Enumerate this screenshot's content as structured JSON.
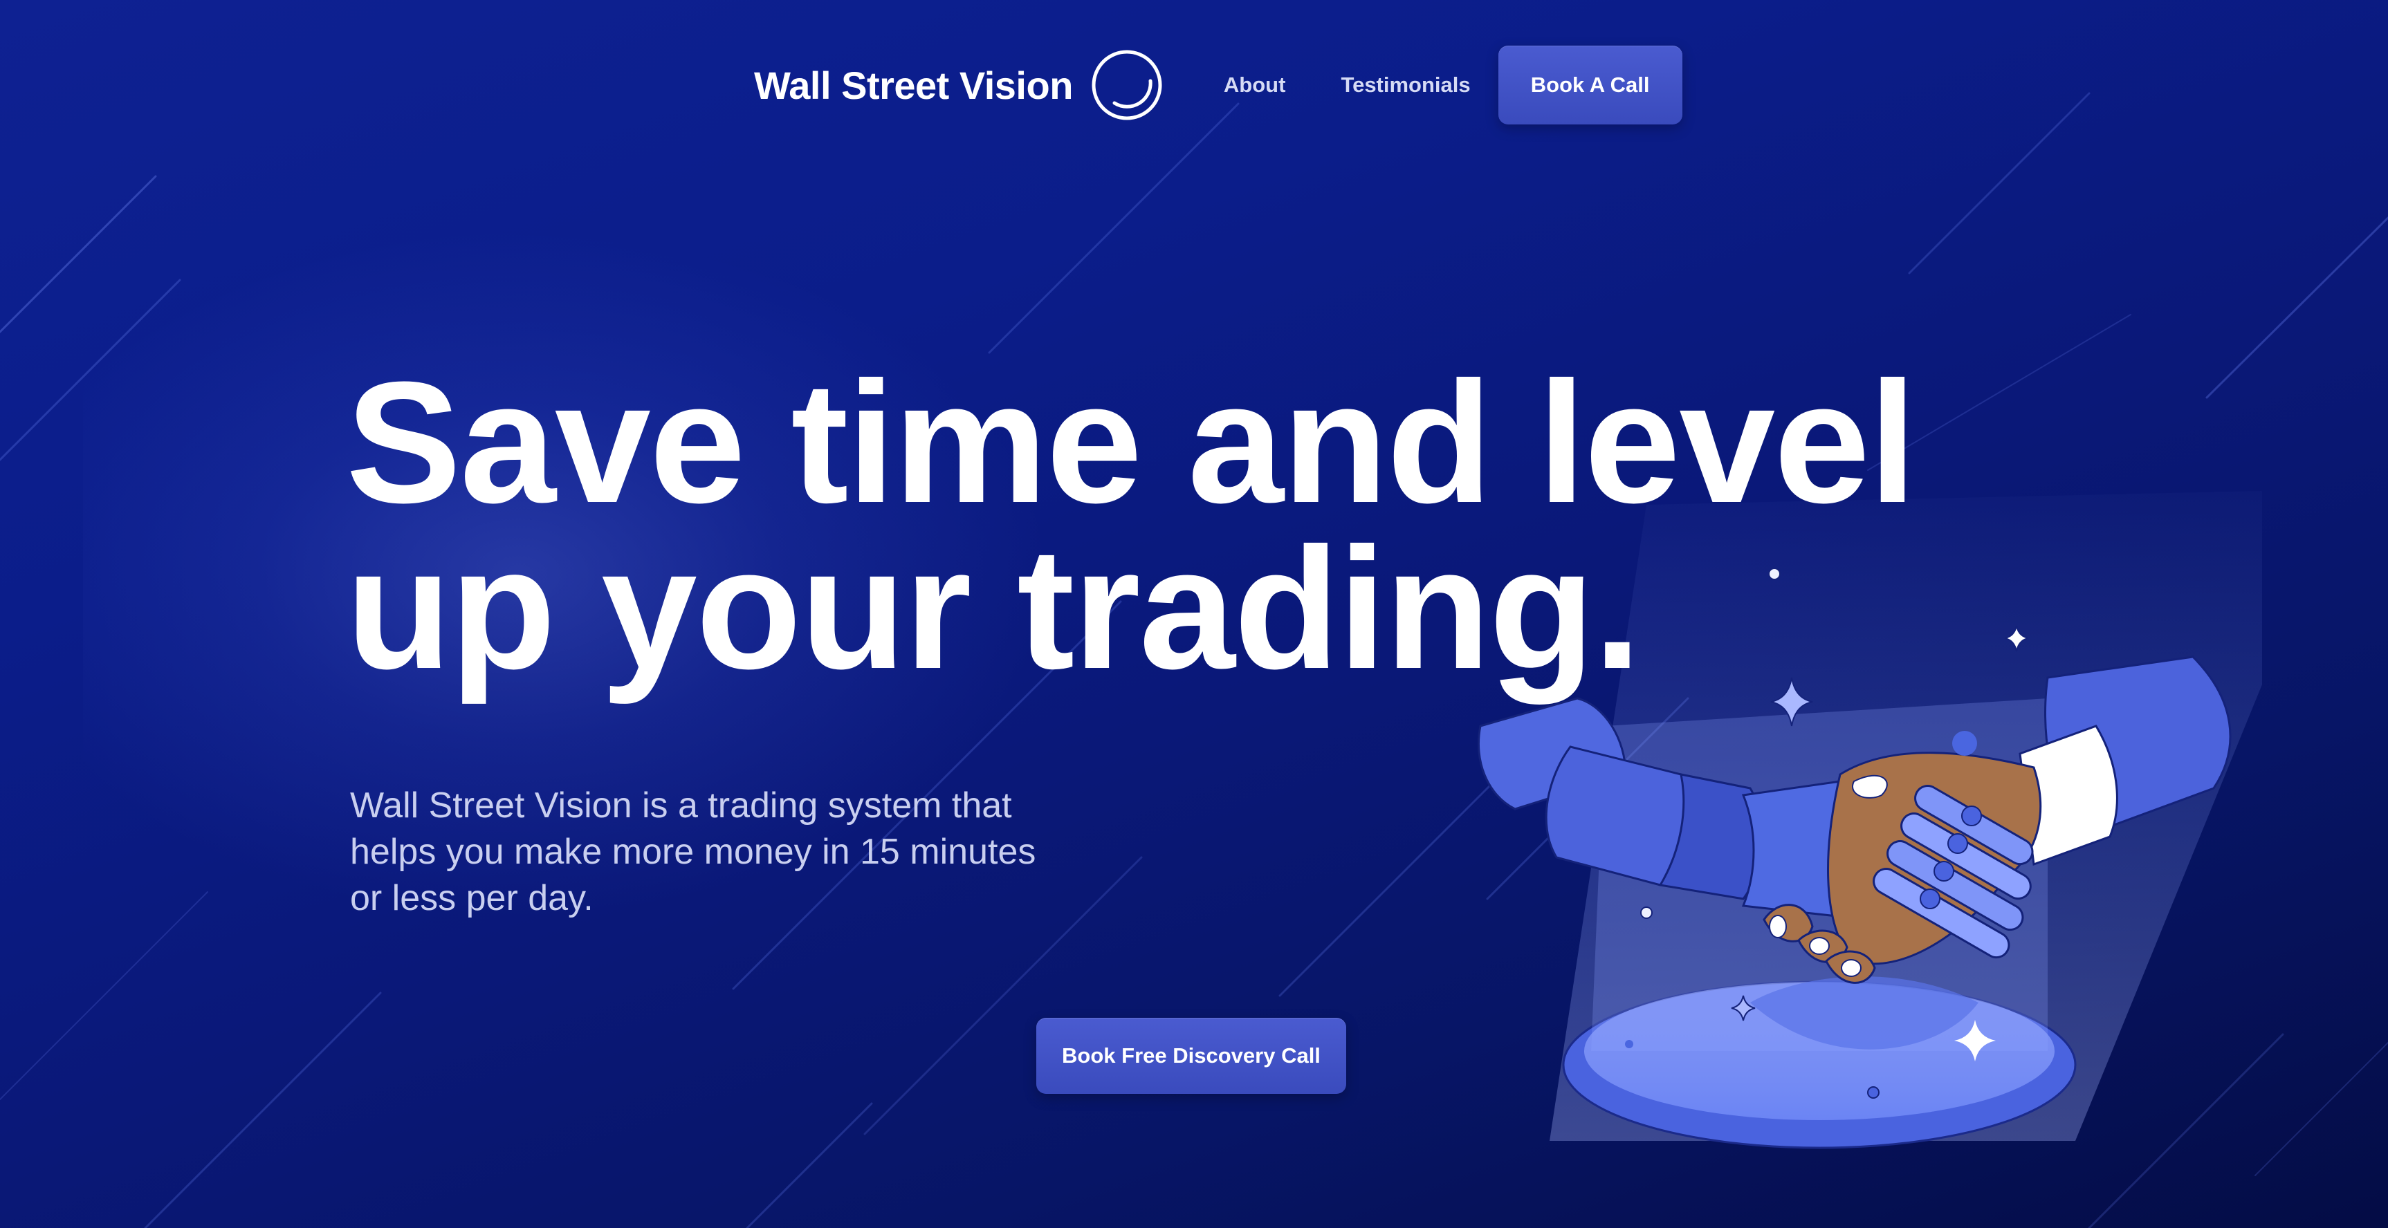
{
  "nav": {
    "brand_name": "Wall Street Vision",
    "logo_icon": "ring-logo-icon",
    "links": [
      {
        "label": "About"
      },
      {
        "label": "Testimonials"
      }
    ],
    "cta_label": "Book A Call"
  },
  "hero": {
    "title_line1": "Save time and level",
    "title_line2": "up your trading.",
    "subtitle": "Wall Street Vision is a trading system that helps you make more money in 15 minutes or less per day.",
    "cta_label": "Book Free Discovery Call",
    "illustration": "robot-human-handshake-illustration"
  },
  "colors": {
    "background": "#0e2192",
    "background_dark": "#040c45",
    "button": "#4254c8",
    "accent_blue": "#4a66e0",
    "skin": "#a8724a"
  }
}
